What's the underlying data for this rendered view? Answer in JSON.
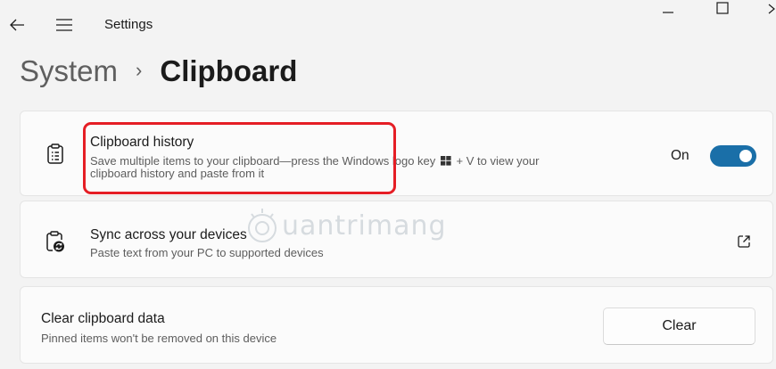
{
  "window": {
    "app_title": "Settings",
    "controls": [
      "minimize-icon",
      "maximize-icon",
      "close-icon"
    ]
  },
  "breadcrumb": {
    "parent": "System",
    "separator": "›",
    "current": "Clipboard"
  },
  "clipboard_history": {
    "title": "Clipboard history",
    "description_part1": "Save multiple items to your clipboard—press the Windows logo key",
    "description_part2": "+ V to view your",
    "description_line2": "clipboard history and paste from it",
    "toggle_label": "On",
    "toggle_on": true,
    "icon": "clipboard-list-icon",
    "highlight_color": "#e51e25"
  },
  "sync": {
    "title": "Sync across your devices",
    "description": "Paste text from your PC to supported devices",
    "icon": "clipboard-sync-icon",
    "action_icon": "open-external-icon"
  },
  "clear_data": {
    "title": "Clear clipboard data",
    "description": "Pinned items won't be removed on this device",
    "button_label": "Clear"
  },
  "watermark": {
    "text": "uantrimang"
  },
  "colors": {
    "accent": "#1a6fa8",
    "background": "#f3f3f3",
    "card": "#fbfbfb"
  }
}
